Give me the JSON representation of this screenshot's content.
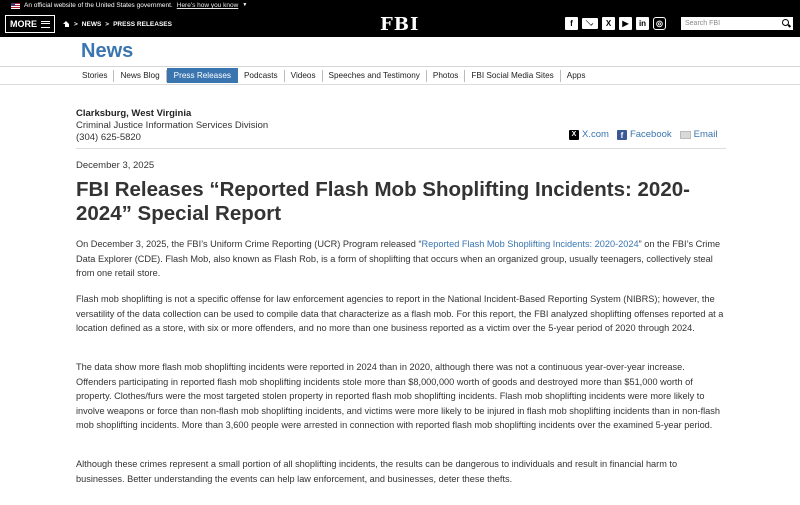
{
  "gov_banner": {
    "text": "An official website of the United States government.",
    "link": "Here's how you know",
    "icon": "us-flag-icon"
  },
  "header": {
    "more_label": "MORE",
    "breadcrumbs": [
      "NEWS",
      "PRESS RELEASES"
    ],
    "logo": "FBI",
    "social_icons": [
      "facebook-icon",
      "email-icon",
      "x-icon",
      "youtube-icon",
      "linkedin-icon",
      "instagram-icon"
    ],
    "search_placeholder": "Search FBI"
  },
  "section_title": "News",
  "subnav": {
    "items": [
      "Stories",
      "News Blog",
      "Press Releases",
      "Podcasts",
      "Videos",
      "Speeches and Testimony",
      "Photos",
      "FBI Social Media Sites",
      "Apps"
    ],
    "active": "Press Releases"
  },
  "contact": {
    "city": "Clarksburg, West Virginia",
    "division": "Criminal Justice Information Services Division",
    "phone": "(304) 625-5820"
  },
  "share": {
    "x": "X.com",
    "facebook": "Facebook",
    "email": "Email"
  },
  "article": {
    "date": "December 3, 2025",
    "headline": "FBI Releases “Reported Flash Mob Shoplifting Incidents: 2020-2024” Special Report",
    "p1_before": "On December 3, 2025, the FBI’s Uniform Crime Reporting (UCR) Program released “",
    "p1_link": "Reported Flash Mob Shoplifting Incidents: 2020-2024",
    "p1_after": "” on the FBI’s Crime Data Explorer (CDE). Flash Mob, also known as Flash Rob, is a form of shoplifting that occurs when an organized group, usually teenagers, collectively steal from one retail store.",
    "p2": "Flash mob shoplifting is not a specific offense for law enforcement agencies to report in the National Incident-Based Reporting System (NIBRS); however, the versatility of the data collection can be used to compile data that characterize as a flash mob. For this report, the FBI analyzed shoplifting offenses reported at a location defined as a store, with six or more offenders, and no more than one business reported as a victim over the 5-year period of 2020 through 2024.",
    "p3": "The data show more flash mob shoplifting incidents were reported in 2024 than in 2020, although there was not a continuous year-over-year increase. Offenders participating in reported flash mob shoplifting incidents stole more than $8,000,000 worth of goods and destroyed more than $51,000 worth of property. Clothes/furs were the most targeted stolen property in reported flash mob shoplifting incidents. Flash mob shoplifting incidents were more likely to involve weapons or force than non-flash mob shoplifting incidents, and victims were more likely to be injured in flash mob shoplifting incidents than in non-flash mob shoplifting incidents. More than 3,600 people were arrested in connection with reported flash mob shoplifting incidents over the examined 5-year period.",
    "p4": "Although these crimes represent a small portion of all shoplifting incidents, the results can be dangerous to individuals and result in financial harm to businesses. Better understanding the events can help law enforcement, and businesses, deter these thefts."
  },
  "colors": {
    "accent": "#3a75b0",
    "header_bg": "#000000",
    "text": "#333333"
  }
}
